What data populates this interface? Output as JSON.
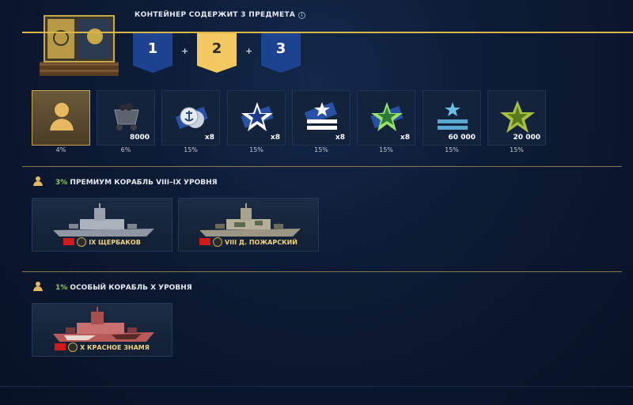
{
  "header": {
    "title": "КОНТЕЙНЕР СОДЕРЖИТ 3 ПРЕДМЕТА",
    "info_glyph": "i",
    "slots": [
      "1",
      "2",
      "3"
    ],
    "plus": "+"
  },
  "items": [
    {
      "icon": "silhouette-icon",
      "qty": "",
      "pct": "4%",
      "selected": true
    },
    {
      "icon": "coal-cart-icon",
      "qty": "8000",
      "pct": "6%"
    },
    {
      "icon": "anchor-coin-icon",
      "qty": "x8",
      "pct": "15%"
    },
    {
      "icon": "blue-star-icon",
      "qty": "x8",
      "pct": "15%"
    },
    {
      "icon": "star-stripes-icon",
      "qty": "x8",
      "pct": "15%"
    },
    {
      "icon": "green-star-icon",
      "qty": "x8",
      "pct": "15%"
    },
    {
      "icon": "free-xp-icon",
      "qty": "60 000",
      "pct": "15%"
    },
    {
      "icon": "gold-star-icon",
      "qty": "20 000",
      "pct": "15%"
    }
  ],
  "sections": [
    {
      "pct": "3%",
      "title": "ПРЕМИУМ КОРАБЛЬ VIII–IX УРОВНЯ",
      "ships": [
        {
          "name": "IX ЩЕРБАКОВ"
        },
        {
          "name": "VIII Д. ПОЖАРСКИЙ"
        }
      ]
    },
    {
      "pct": "1%",
      "title": "ОСОБЫЙ КОРАБЛЬ X УРОВНЯ",
      "ships": [
        {
          "name": "X КРАСНОЕ ЗНАМЯ"
        }
      ]
    }
  ],
  "colors": {
    "accent_gold": "#d9b54a",
    "slot_blue": "#1d4290",
    "slot_gold": "#f3c860",
    "percent_green": "#8ec85a"
  }
}
